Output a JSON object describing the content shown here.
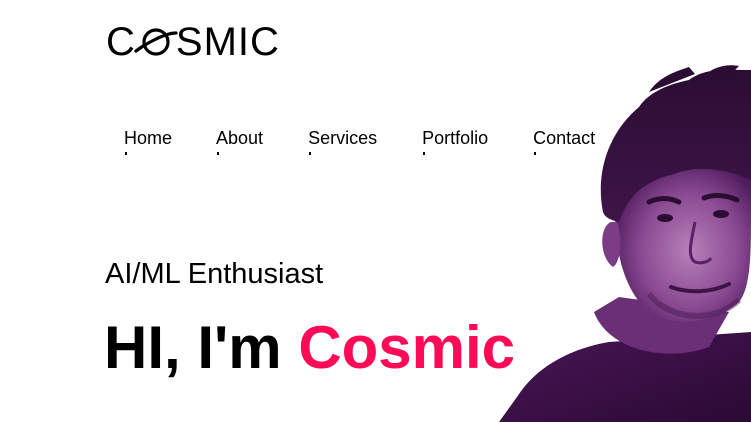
{
  "brand": {
    "logo_prefix": "C",
    "logo_suffix": "SMIC",
    "logo_icon": "planet-icon"
  },
  "nav": {
    "items": [
      {
        "label": "Home"
      },
      {
        "label": "About"
      },
      {
        "label": "Services"
      },
      {
        "label": "Portfolio"
      },
      {
        "label": "Contact"
      }
    ]
  },
  "hero": {
    "subtitle": "AI/ML Enthusiast",
    "greeting": "HI, I'm",
    "name": "Cosmic",
    "accent_color": "#ff0a57"
  },
  "portrait": {
    "icon": "profile-portrait",
    "tint_color": "#5a1a6e"
  }
}
